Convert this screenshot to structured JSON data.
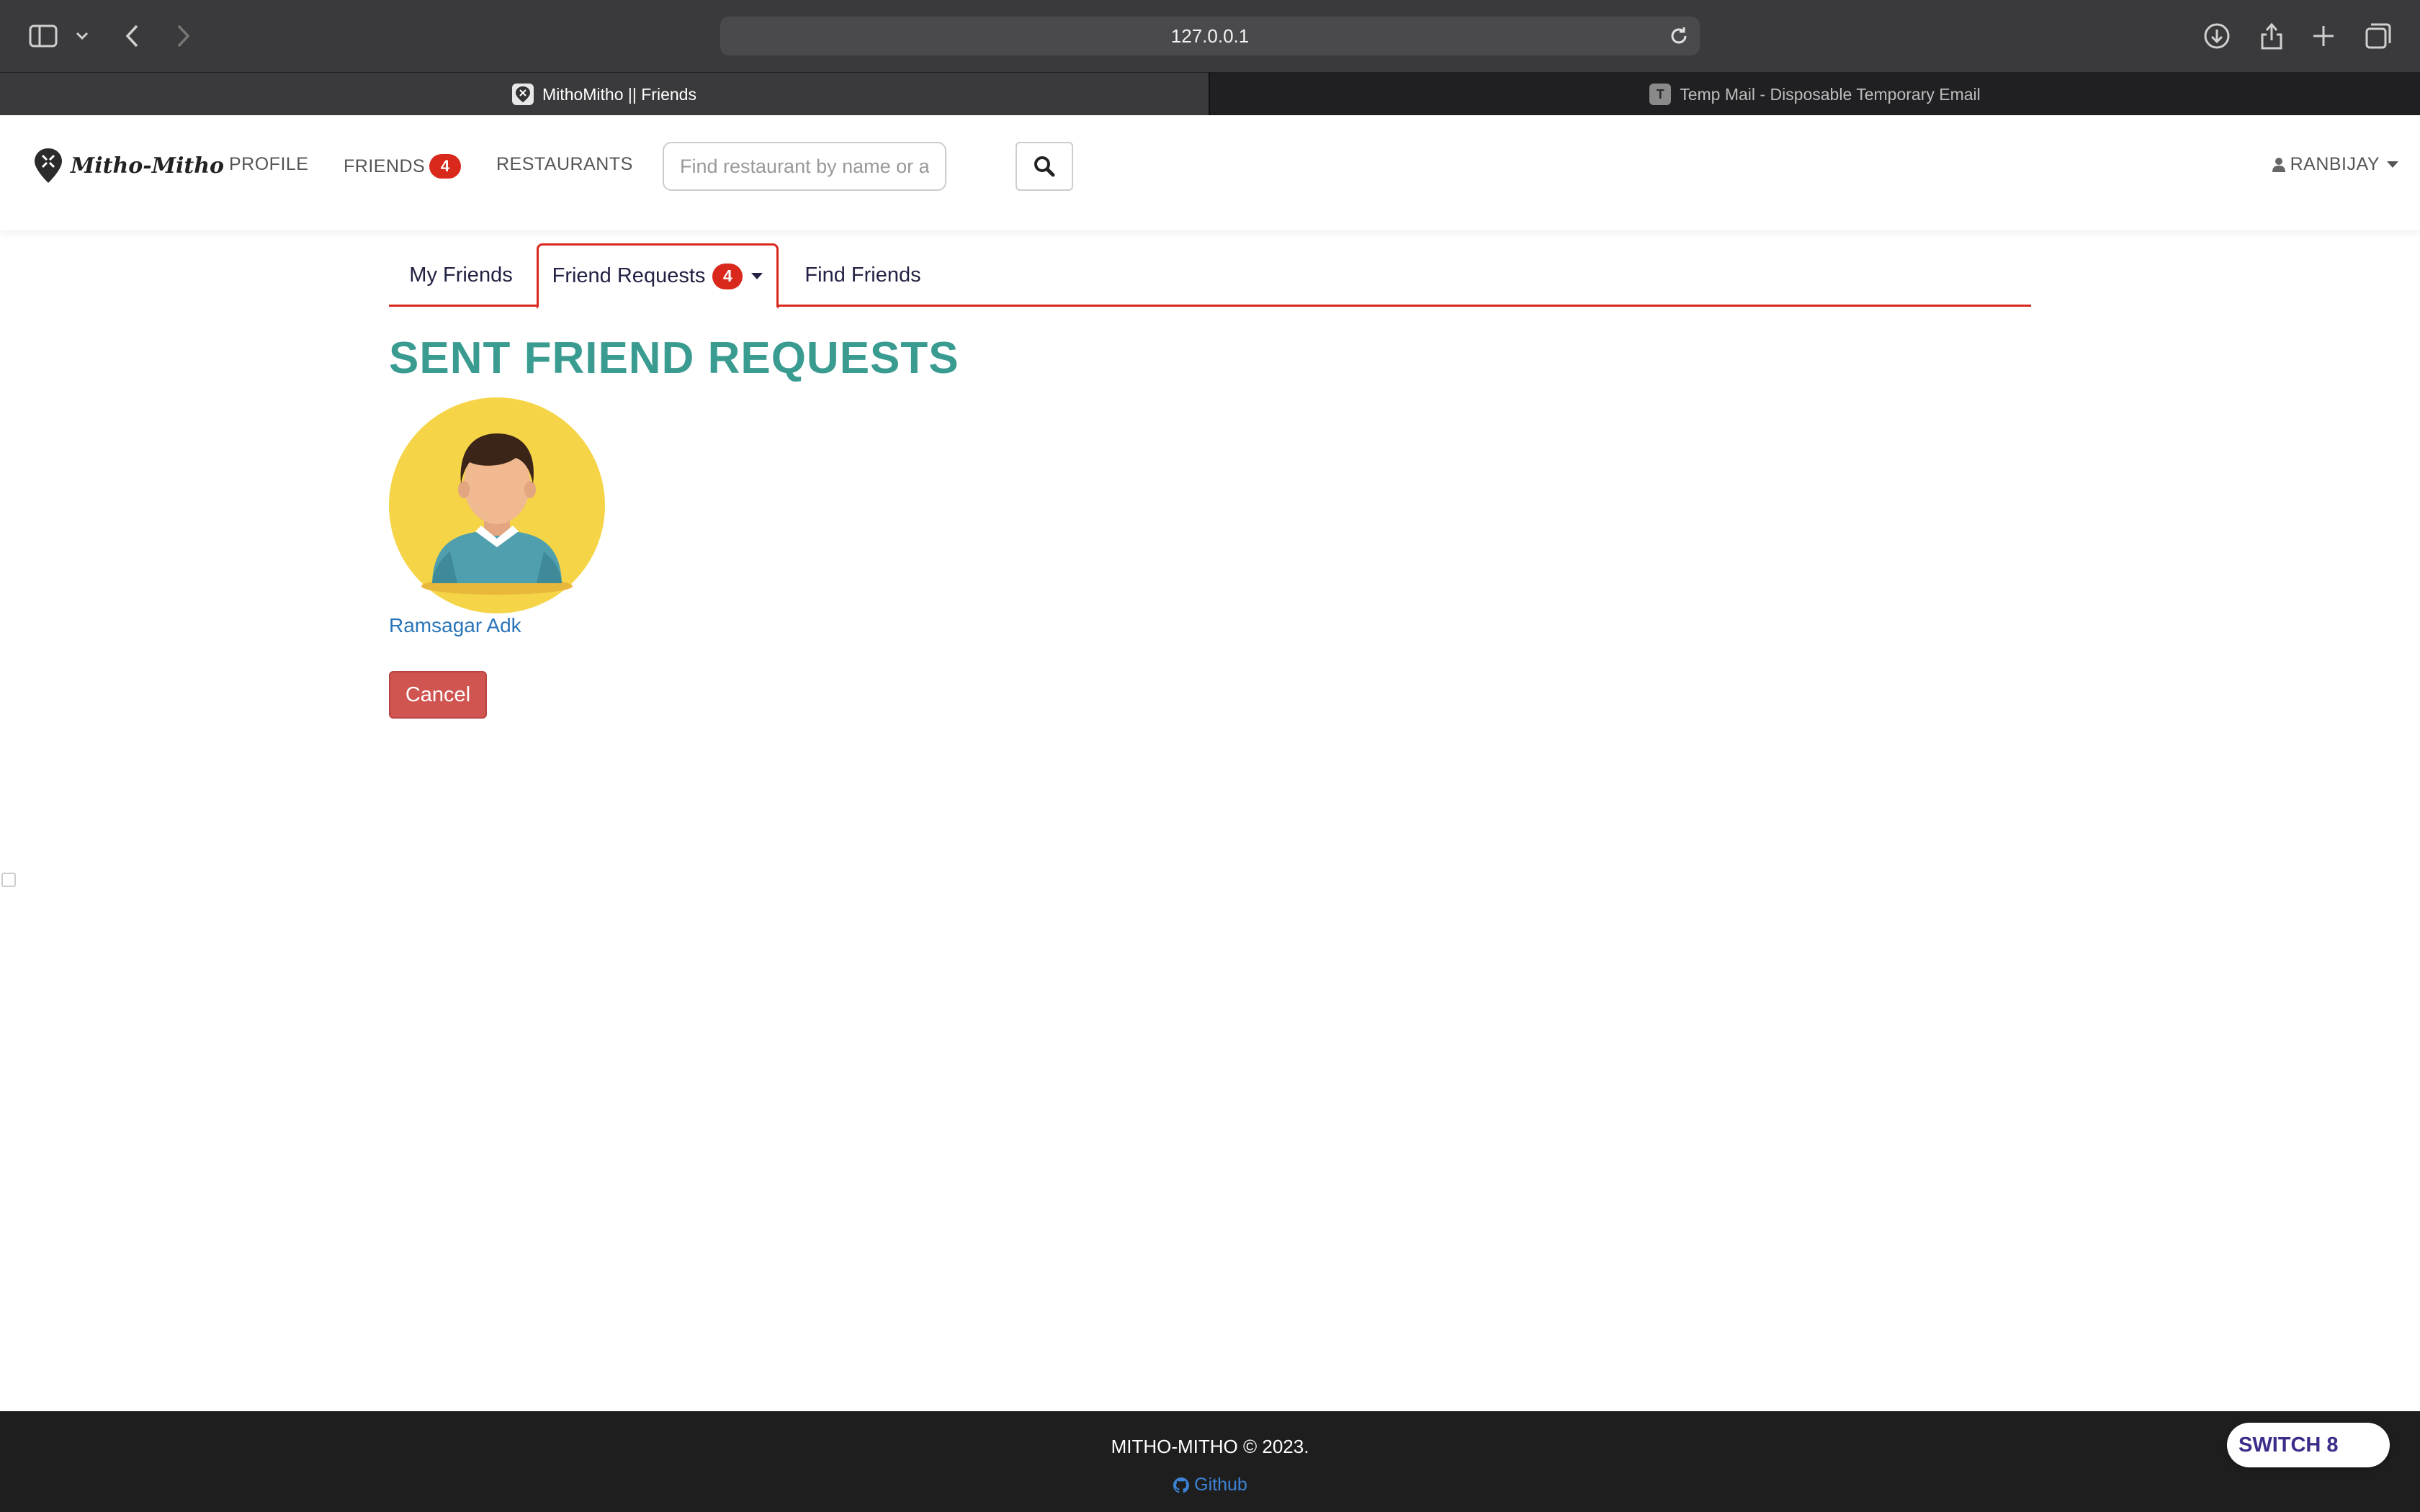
{
  "browser": {
    "url": "127.0.0.1",
    "tabs": [
      {
        "title": "MithoMitho || Friends",
        "active": true
      },
      {
        "title": "Temp Mail - Disposable Temporary Email",
        "favicon_letter": "T",
        "active": false
      }
    ]
  },
  "navbar": {
    "brand": "Mitho-Mitho",
    "links": {
      "profile": "PROFILE",
      "friends": "FRIENDS",
      "friends_badge": "4",
      "restaurants": "RESTAURANTS"
    },
    "search": {
      "placeholder": "Find restaurant by name or a"
    },
    "user": "RANBIJAY"
  },
  "friend_tabs": {
    "my_friends": "My Friends",
    "friend_requests": "Friend Requests",
    "friend_requests_badge": "4",
    "find_friends": "Find Friends"
  },
  "main": {
    "title": "SENT FRIEND REQUESTS",
    "requests": [
      {
        "name": "Ramsagar Adk",
        "action": "Cancel"
      }
    ]
  },
  "footer": {
    "copyright": "MITHO-MITHO © 2023.",
    "link": "Github"
  },
  "switch_button": "SWITCH 8",
  "colors": {
    "accent_red": "#d9281c",
    "title_teal": "#3a9b91",
    "link_blue": "#2a74b9",
    "cancel_red": "#d05450",
    "footer_bg": "#1e1e1e"
  }
}
